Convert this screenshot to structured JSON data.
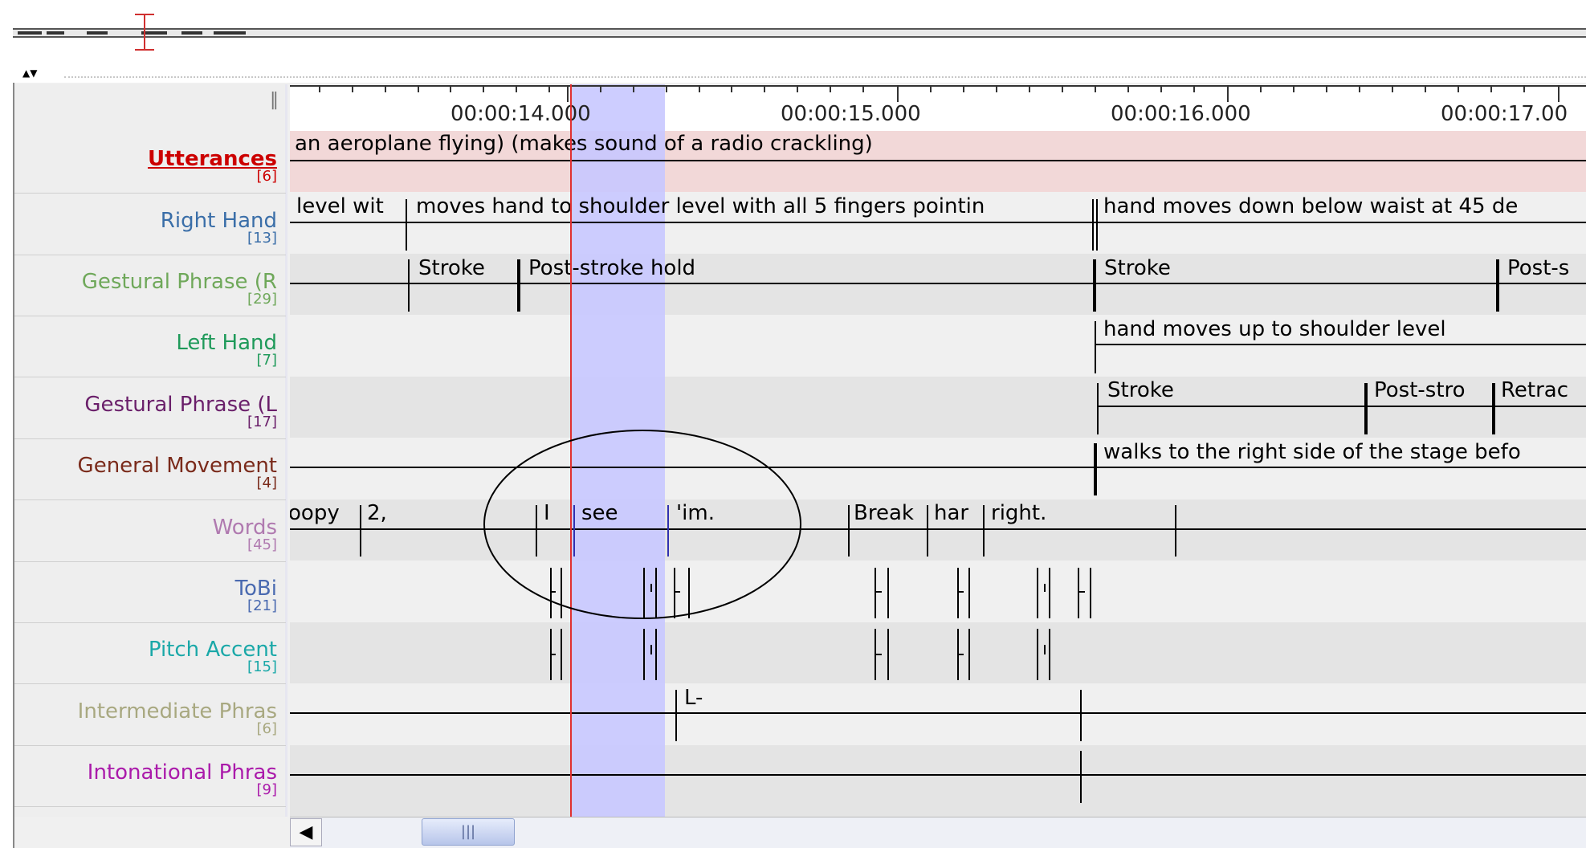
{
  "overview": {
    "icon": "overview-strip"
  },
  "tier_nav": {
    "label": "▲▼"
  },
  "ruler": {
    "ticks": [
      {
        "label": "00:00:14.000"
      },
      {
        "label": "00:00:15.000"
      },
      {
        "label": "00:00:16.000"
      },
      {
        "label": "00:00:17.00"
      }
    ]
  },
  "tiers": [
    {
      "name": "Utterances",
      "count": "[6]",
      "color": "#cc0000",
      "underline": true
    },
    {
      "name": "Right Hand",
      "count": "[13]",
      "color": "#3a6ea8"
    },
    {
      "name": "Gestural Phrase (R",
      "count": "[29]",
      "color": "#6fa85a"
    },
    {
      "name": "Left Hand",
      "count": "[7]",
      "color": "#1f9a5a"
    },
    {
      "name": "Gestural Phrase (L",
      "count": "[17]",
      "color": "#6a1f6a"
    },
    {
      "name": "General Movement",
      "count": "[4]",
      "color": "#7a2a1a"
    },
    {
      "name": "Words",
      "count": "[45]",
      "color": "#b07ab0"
    },
    {
      "name": "ToBi",
      "count": "[21]",
      "color": "#4a6ab0"
    },
    {
      "name": "Pitch Accent",
      "count": "[15]",
      "color": "#1aa8a8"
    },
    {
      "name": "Intermediate Phras",
      "count": "[6]",
      "color": "#a8a880"
    },
    {
      "name": "Intonational Phras",
      "count": "[9]",
      "color": "#aa1aaa"
    }
  ],
  "annotations": {
    "utterances": "an aeroplane flying) (makes sound of a radio crackling)",
    "right_hand": [
      "level wit",
      "moves hand to shoulder level with all 5 fingers pointin",
      "hand moves down below waist at 45 de"
    ],
    "gestural_r": [
      "Stroke",
      "Post-stroke hold",
      "Stroke",
      "Post-s"
    ],
    "left_hand": [
      "hand moves up to shoulder level"
    ],
    "gestural_l": [
      "Stroke",
      "Post-stro",
      "Retrac"
    ],
    "general_movement": [
      "walks to the right side of the stage befo"
    ],
    "words": [
      "oopy",
      "2,",
      "I",
      "see",
      "'im.",
      "Break",
      "har",
      "right."
    ],
    "intermediate": [
      "L-"
    ]
  },
  "colors": {
    "cursor": "#e03030",
    "selection": "#c8c8ff",
    "utterance_bg": "#f2d8d8"
  }
}
